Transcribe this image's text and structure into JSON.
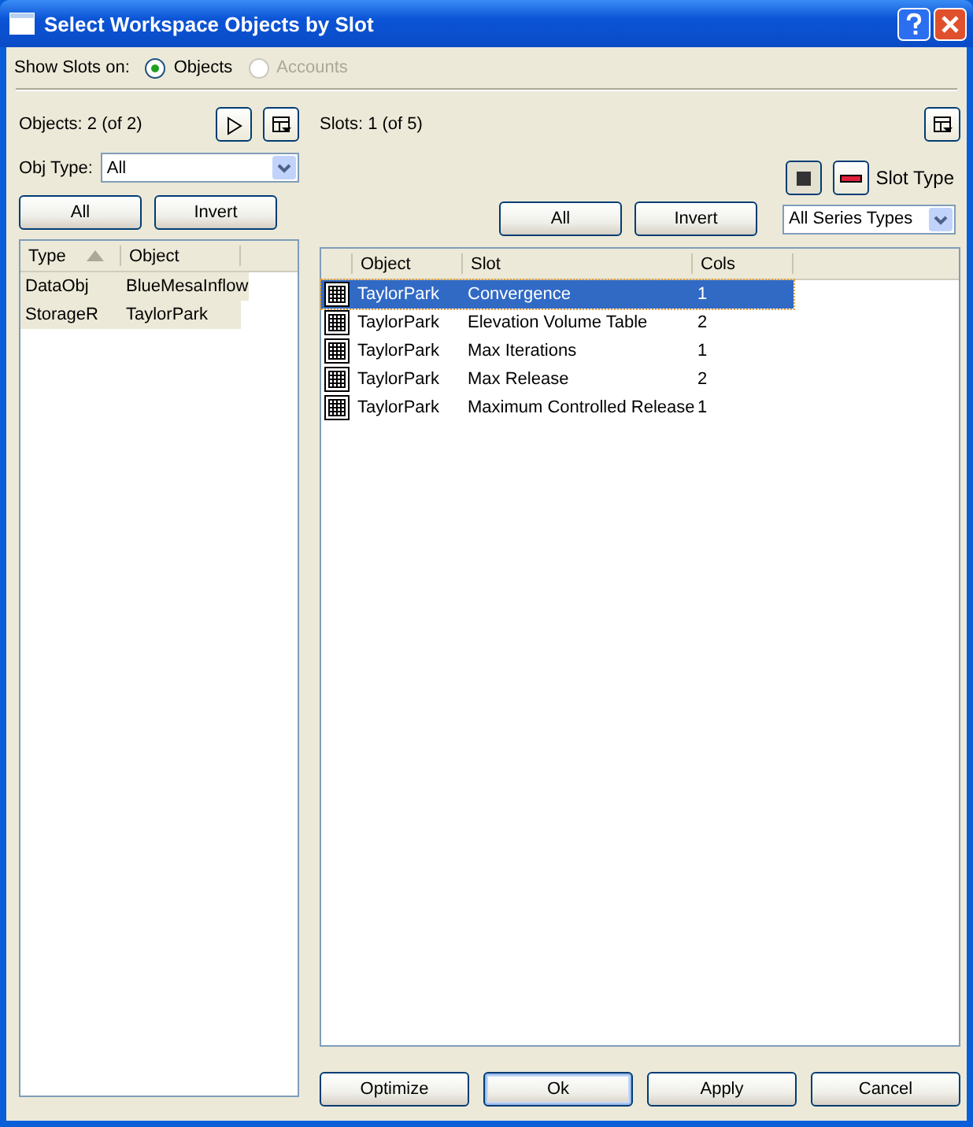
{
  "window": {
    "title": "Select Workspace Objects by Slot"
  },
  "show_slots_on": {
    "label": "Show Slots on:",
    "options": [
      {
        "label": "Objects",
        "selected": true,
        "disabled": false
      },
      {
        "label": "Accounts",
        "selected": false,
        "disabled": true
      }
    ]
  },
  "objects_panel": {
    "count": "Objects: 2 (of 2)",
    "obj_type": {
      "label": "Obj Type:",
      "value": "All"
    },
    "buttons": [
      "All",
      "Invert"
    ],
    "columns": [
      {
        "label": "Type",
        "sorted": true
      },
      {
        "label": "Object",
        "sorted": false
      }
    ],
    "rows": [
      {
        "cells": [
          "DataObj",
          "BlueMesaInflow"
        ],
        "selected": true
      },
      {
        "cells": [
          "StorageR",
          "TaylorPark"
        ],
        "selected": true
      }
    ]
  },
  "slots_panel": {
    "count": "Slots: 1 (of 5)",
    "slot_type": {
      "label": "Slot Type",
      "value": "All Series Types"
    },
    "buttons": [
      "All",
      "Invert"
    ],
    "columns": [
      "Object",
      "Slot",
      "Cols"
    ],
    "rows": [
      {
        "cells": [
          "TaylorPark",
          "Convergence",
          "1"
        ],
        "selected": true
      },
      {
        "cells": [
          "TaylorPark",
          "Elevation Volume Table",
          "2"
        ],
        "selected": false
      },
      {
        "cells": [
          "TaylorPark",
          "Max Iterations",
          "1"
        ],
        "selected": false
      },
      {
        "cells": [
          "TaylorPark",
          "Max Release",
          "2"
        ],
        "selected": false
      },
      {
        "cells": [
          "TaylorPark",
          "Maximum Controlled Release",
          "1"
        ],
        "selected": false
      }
    ]
  },
  "buttons": [
    {
      "label": "Optimize",
      "default": false
    },
    {
      "label": "Ok",
      "default": true
    },
    {
      "label": "Apply",
      "default": false
    },
    {
      "label": "Cancel",
      "default": false
    }
  ]
}
